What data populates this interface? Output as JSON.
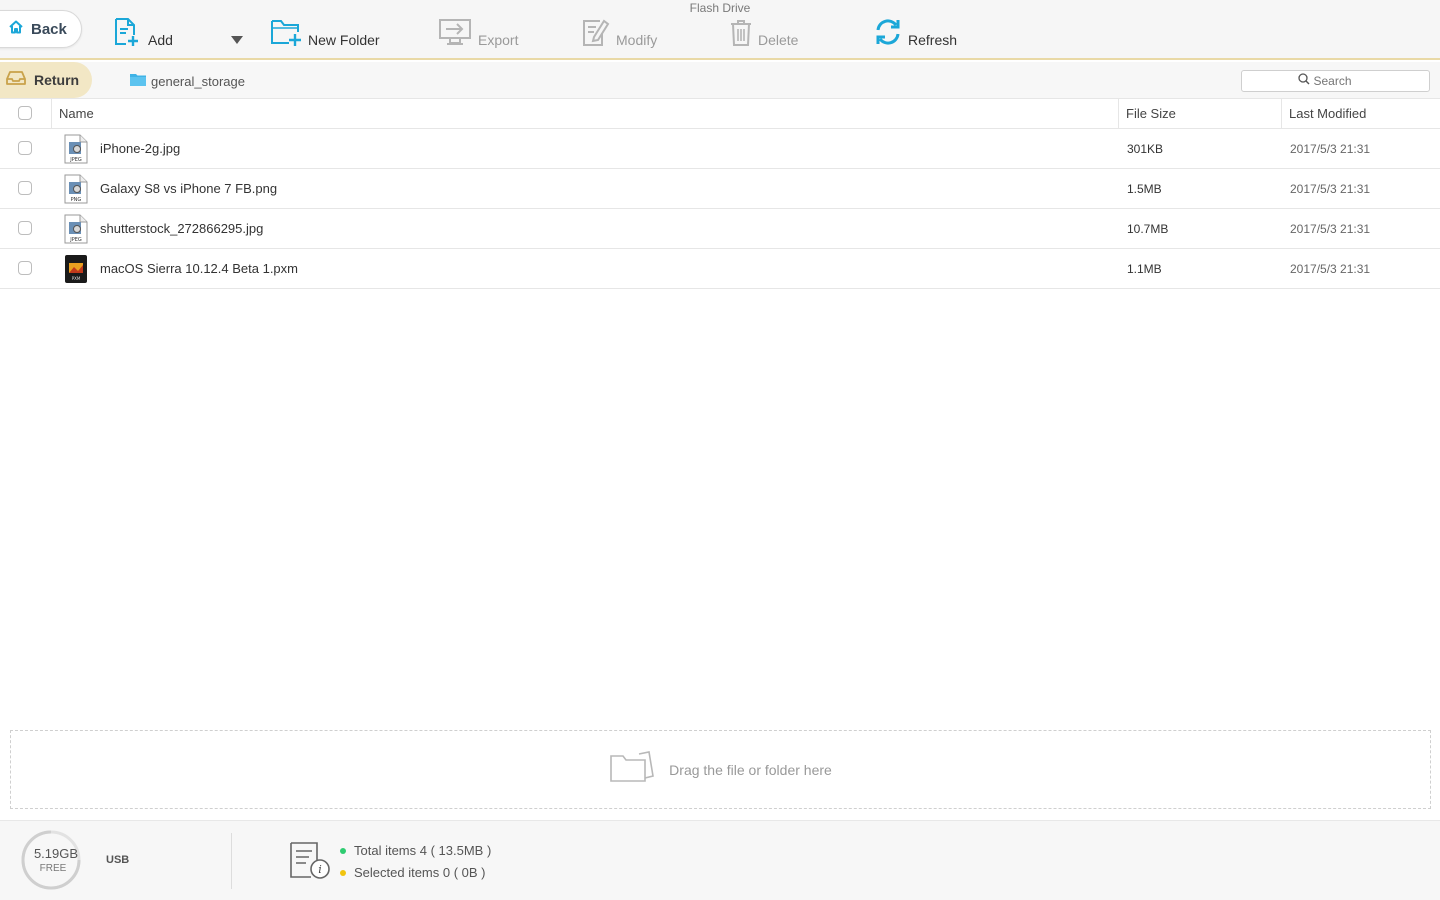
{
  "window": {
    "title": "Flash Drive"
  },
  "toolbar": {
    "back": "Back",
    "add": "Add",
    "new_folder": "New Folder",
    "export": "Export",
    "modify": "Modify",
    "delete": "Delete",
    "refresh": "Refresh"
  },
  "breadcrumb": {
    "return": "Return",
    "folder": "general_storage"
  },
  "search": {
    "placeholder": "Search"
  },
  "table": {
    "columns": {
      "name": "Name",
      "size": "File Size",
      "modified": "Last Modified"
    },
    "rows": [
      {
        "name": "iPhone-2g.jpg",
        "size": "301KB",
        "modified": "2017/5/3  21:31",
        "icon": "jpeg-file-icon",
        "badge": "JPEG"
      },
      {
        "name": "Galaxy S8 vs iPhone 7 FB.png",
        "size": "1.5MB",
        "modified": "2017/5/3  21:31",
        "icon": "png-file-icon",
        "badge": "PNG"
      },
      {
        "name": "shutterstock_272866295.jpg",
        "size": "10.7MB",
        "modified": "2017/5/3  21:31",
        "icon": "jpeg-file-icon",
        "badge": "JPEG"
      },
      {
        "name": "macOS Sierra 10.12.4 Beta 1.pxm",
        "size": "1.1MB",
        "modified": "2017/5/3  21:31",
        "icon": "pxm-file-icon",
        "badge": "PXM"
      }
    ]
  },
  "dropzone": {
    "text": "Drag the file or folder here"
  },
  "footer": {
    "free_space": "5.19GB",
    "free_label": "FREE",
    "device": "USB",
    "total": "Total items 4 ( 13.5MB )",
    "selected": "Selected items 0 ( 0B )"
  },
  "colors": {
    "accent": "#1ba7d8",
    "accent_gold": "#e9d9a6",
    "return_bg": "#f2e7c5",
    "total_dot": "#2ecc71",
    "selected_dot": "#f1c40f",
    "disabled": "#b5b5b5"
  }
}
